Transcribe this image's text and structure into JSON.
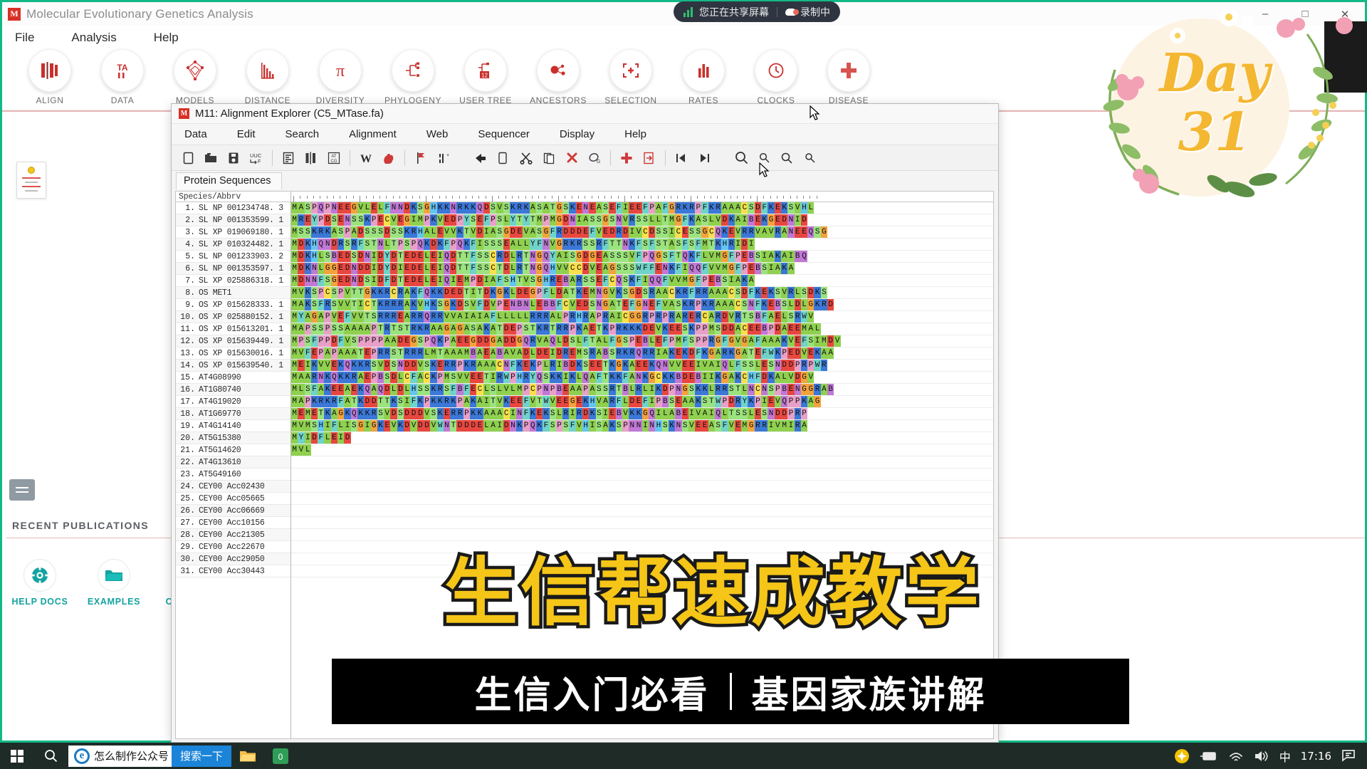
{
  "mega": {
    "title": "Molecular Evolutionary Genetics Analysis",
    "logo_text": "M",
    "menu": [
      "File",
      "Analysis",
      "Help"
    ],
    "window_controls": [
      "–",
      "□",
      "✕"
    ],
    "toolbar": [
      {
        "label": "ALIGN",
        "icon": "align-icon"
      },
      {
        "label": "DATA",
        "icon": "data-ta-icon"
      },
      {
        "label": "MODELS",
        "icon": "models-lattice-icon"
      },
      {
        "label": "DISTANCE",
        "icon": "distance-histogram-icon"
      },
      {
        "label": "DIVERSITY",
        "icon": "diversity-pi-icon"
      },
      {
        "label": "PHYLOGENY",
        "icon": "phylogeny-tree-icon"
      },
      {
        "label": "USER TREE",
        "icon": "user-tree-icon"
      },
      {
        "label": "ANCESTORS",
        "icon": "ancestors-nodes-icon"
      },
      {
        "label": "SELECTION",
        "icon": "selection-brackets-icon"
      },
      {
        "label": "RATES",
        "icon": "rates-bars-icon"
      },
      {
        "label": "CLOCKS",
        "icon": "clocks-clock-icon"
      },
      {
        "label": "DISEASE",
        "icon": "disease-cross-icon"
      }
    ],
    "recent_publications_label": "RECENT PUBLICATIONS",
    "bottom_actions": [
      {
        "label": "HELP DOCS",
        "icon": "lifebuoy-icon"
      },
      {
        "label": "EXAMPLES",
        "icon": "folder-icon"
      },
      {
        "label": "CITATION",
        "icon": "quote-icon"
      }
    ]
  },
  "align_window": {
    "title": "M11: Alignment Explorer (C5_MTase.fa)",
    "logo_text": "M",
    "menu": [
      "Data",
      "Edit",
      "Search",
      "Alignment",
      "Web",
      "Sequencer",
      "Display",
      "Help"
    ],
    "tab": "Protein Sequences",
    "toolbar_icons": [
      "new-file-icon",
      "open-folder-icon",
      "save-icon",
      "translate-uuc-icon",
      "sep",
      "edit-sequence-icon",
      "align-columns-icon",
      "atcg-toggle-icon",
      "sep",
      "w-clustalw-icon",
      "muscle-hand-icon",
      "sep",
      "flag-marker-icon",
      "insert-site-icon",
      "gap",
      "undo-arrow-icon",
      "copy-icon",
      "cut-scissors-icon",
      "paste-icon",
      "delete-x-icon",
      "delete-gaps-icon",
      "sep",
      "add-plus-icon",
      "export-icon",
      "sep",
      "prev-marker-icon",
      "next-marker-icon",
      "gap",
      "zoom-in-icon",
      "zoom-small-icon",
      "zoom-medium-icon",
      "zoom-out-icon"
    ],
    "name_header": "Species/Abbrv",
    "rows": [
      {
        "index": "1.",
        "name": "SL NP 001234748. 3"
      },
      {
        "index": "2.",
        "name": "SL NP 001353599. 1"
      },
      {
        "index": "3.",
        "name": "SL XP 019069180. 1"
      },
      {
        "index": "4.",
        "name": "SL XP 010324482. 1"
      },
      {
        "index": "5.",
        "name": "SL NP 001233903. 2"
      },
      {
        "index": "6.",
        "name": "SL NP 001353597. 1"
      },
      {
        "index": "7.",
        "name": "SL XP 025886318. 1"
      },
      {
        "index": "8.",
        "name": "OS MET1"
      },
      {
        "index": "9.",
        "name": "OS XP 015628333. 1"
      },
      {
        "index": "10.",
        "name": "OS XP 025880152. 1"
      },
      {
        "index": "11.",
        "name": "OS XP 015613201. 1"
      },
      {
        "index": "12.",
        "name": "OS XP 015639449. 1"
      },
      {
        "index": "13.",
        "name": "OS XP 015630016. 1"
      },
      {
        "index": "14.",
        "name": "OS XP 015639540. 1"
      },
      {
        "index": "15.",
        "name": "AT4G08990"
      },
      {
        "index": "16.",
        "name": "AT1G80740"
      },
      {
        "index": "17.",
        "name": "AT4G19020"
      },
      {
        "index": "18.",
        "name": "AT1G69770"
      },
      {
        "index": "19.",
        "name": "AT4G14140"
      },
      {
        "index": "20.",
        "name": "AT5G15380"
      },
      {
        "index": "21.",
        "name": "AT5G14620"
      },
      {
        "index": "22.",
        "name": "AT4G13610"
      },
      {
        "index": "23.",
        "name": "AT5G49160"
      },
      {
        "index": "24.",
        "name": "CEY00 Acc02430"
      },
      {
        "index": "25.",
        "name": "CEY00 Acc05665"
      },
      {
        "index": "26.",
        "name": "CEY00 Acc06669"
      },
      {
        "index": "27.",
        "name": "CEY00 Acc10156"
      },
      {
        "index": "28.",
        "name": "CEY00 Acc21305"
      },
      {
        "index": "29.",
        "name": "CEY00 Acc22670"
      },
      {
        "index": "30.",
        "name": "CEY00 Acc29050"
      },
      {
        "index": "31.",
        "name": "CEY00 Acc30443"
      }
    ],
    "sequences": [
      "MASPQPNEEGVLELFNNDKSGHKKNRKKQDSVSKRKASATGSKENEASEFIEEFPAFGRKRPFKRAAACSDFKEKSVHL",
      "MREYPDSENSSKPECVEGIMPKVEDPYSEFPSLYTYTMPMGDNIASSGSNVRSSLLTMGFKASLVDKAIBEKGEDNID",
      "MSSKRKASPADSSSDSSKRHALEVVKTVDIASGDEVASGFRDDDEFVEDRDIVCDSSICESSGCQKEVRRVAVRANEEQSG",
      "MDKHQNDRSRFSTNLTPSPQKDKFPQKFISSSEALLYFNVGRKRSSRFTTNKFSFSTASFSFMTKHRIDI",
      "MDKHLSBEDSDNIDYDTEDELEIQDTTFSSCRDLRTNGQYAISGDGEASSSVFPQGSFTQKFLVMGFPEBSIAKAIBQ",
      "MDKNLGGEDNDDIDYDIEDELEIQDTTFSSCTDLRTNGQHVVCCDVEAGSSSWFFENKFIQQFVVMGFPEBSIAKA",
      "MDNNFSGEDNDSIDFDTEDELEIQIEMPDIAFSHTVSGHREBARSSEFCQSKFIQQFVVMGFPEBSIAKA",
      "MVKSPCSPVTTGKKRCRAKFQKKDEDTITDKGKLDEGPFLDATKEMNGVKSGDSRAACKRFRRAAACSDFKEKSVRLSDKS",
      "MAKSFRSVVTICTKRRRAKVHKSGKDSVFDVPENBNLEBBFCVEDSNGATEFGNEFVASKRPKRAAACSNFKEBSLDLGKRD",
      "MYAGAPVEFVVTSRRREARRQRRVVAIAIAFLLLLLRRRALPRHRAPRAICGGRPRPRARERCARDVRTSBFAELSRWV",
      "MAPSSPSSAAAAPTRTSTRKRAAGAGASAKATDEPSTKRTRRPKAETKPRKKKDEVKEESKPPMSDDACEEBPDAEEMAL",
      "MPSFPPDFVSPPPPAADEGSPQKPAEEGDDGADDGQRVAQLDSLFTALFGSPEBLEFPMFSPPRGFGVGAFAAAKVEFSIMDV",
      "MVFEPAPAAATEPRRSTRRRLMTAAAMBAEABAVADLDEIDREMSRABSRKRQRRIAKEKDFKGARKGATEFWKPEDVEKAA",
      "MEIKVVEKQKKRSVDSNDDVSKERRPKRAAACNFKEKPLRIBDKSEETKGKAEEKQNVVEEIVAIQLFSSLESNDDPRPWR",
      "MAARNKQKKRAEPBSDLCFACKPMSVVEETIRWPHRYQSKKIKLQAFTKKFANKGCKKBDEBIIKGAKCHFDKALVDGV",
      "MLSFAKEEAEKQAQDLDLHSSKRSFBFECLSLVLMPCPNPBEAAPASSRTBLRLIKDPNGSKKLRRSTLNCNSPBENGGRAB",
      "MAPKRKRFATKDDTTKSIFKPKKRKPAKAITVKEEFVTWVEEGEKHVARFLDEFIPBSEAAKSTWPDRYKPIEVQPPKAG",
      "MEMETKAGKQKKRSVDSDDDVSKERRPKKAAACINFKEKSLRIRDKSIEBVKKGQILABEIVAIQLTSSLESNDDPRP",
      "MVMSHIFLISGIGKEVKDVDDVWNTDDDELAIDNKPQKFSPSFVHISAKSPNNINHSKNSVEEASFVEMGRRIVMIRA",
      "MYIDFLEID",
      "MVL",
      "",
      "",
      "",
      "",
      "",
      "",
      "",
      "",
      "",
      ""
    ]
  },
  "overlays": {
    "share_banner": {
      "sharing_text": "您正在共享屏幕",
      "recording_text": "录制中"
    },
    "wreath": {
      "day_word": "Day",
      "day_number": "31"
    },
    "caption_main": "生信帮速成教学",
    "caption_left": "生信入门必看",
    "caption_right": "基因家族讲解"
  },
  "taskbar": {
    "ie_label": "怎么制作公众号",
    "search_button": "搜索一下",
    "clock": "17:16",
    "ime": "中",
    "icons": [
      "windows-start-icon",
      "search-icon",
      "ie-icon",
      "explorer-icon",
      "app-icon"
    ],
    "tray_icons": [
      "shield-update-icon",
      "battery-icon",
      "wifi-icon",
      "volume-icon",
      "notification-icon"
    ]
  },
  "colors": {
    "mega_accent": "#12b886",
    "mega_icon_red": "#c9302c",
    "teal": "#13a3a0",
    "caption_yellow": "#f5c518",
    "taskbar_bg": "#1f2b26"
  }
}
